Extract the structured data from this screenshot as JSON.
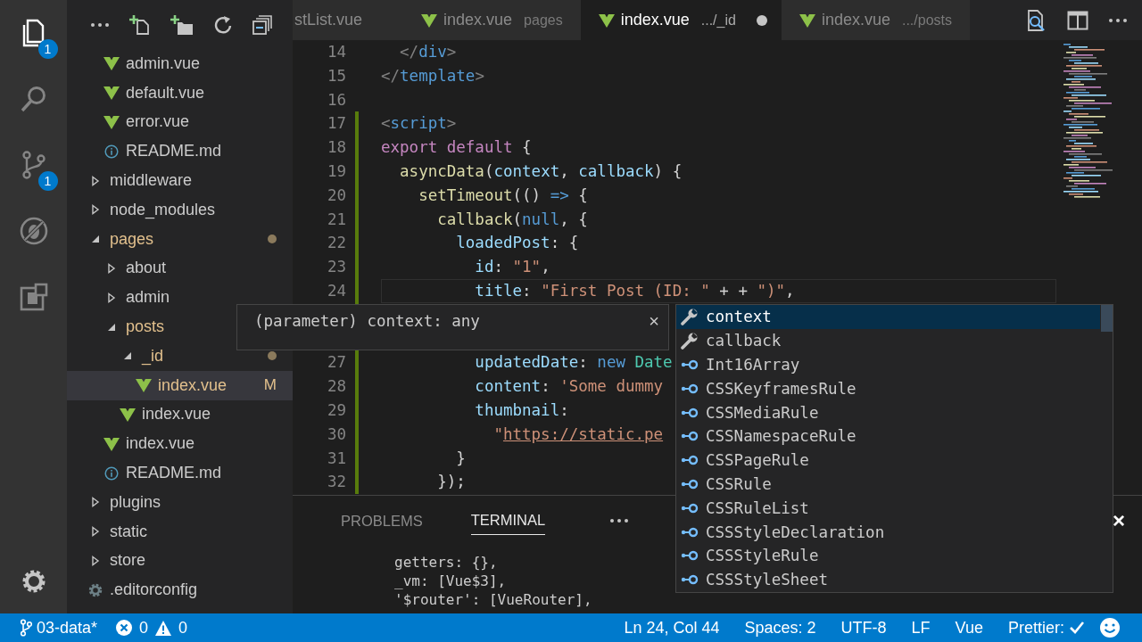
{
  "activity_bar": {
    "items": [
      {
        "kind": "files",
        "selected": true,
        "badge": "1"
      },
      {
        "kind": "search",
        "selected": false
      },
      {
        "kind": "branch",
        "selected": false,
        "badge": "1"
      },
      {
        "kind": "debug",
        "selected": false
      },
      {
        "kind": "extensions",
        "selected": false
      }
    ]
  },
  "sidebar": {
    "tree": [
      {
        "children": [
          {
            "label": "admin.vue",
            "kind": "vue",
            "selected": false
          },
          {
            "label": "default.vue",
            "kind": "vue",
            "selected": false
          },
          {
            "label": "error.vue",
            "kind": "vue",
            "selected": false
          },
          {
            "label": "README.md",
            "kind": "info",
            "selected": false
          }
        ]
      },
      {
        "label": "middleware",
        "kind": "folder",
        "expanded": false,
        "selected": false
      },
      {
        "label": "node_modules",
        "kind": "folder",
        "expanded": false,
        "selected": false
      },
      {
        "label": "pages",
        "kind": "folder",
        "expanded": true,
        "selected": false,
        "modified": true,
        "dot": true,
        "children": [
          {
            "label": "about",
            "kind": "folder",
            "expanded": false,
            "selected": false
          },
          {
            "label": "admin",
            "kind": "folder",
            "expanded": false,
            "selected": false
          },
          {
            "label": "posts",
            "kind": "folder",
            "expanded": true,
            "selected": false,
            "modified": true,
            "children": [
              {
                "label": "_id",
                "kind": "folder",
                "expanded": true,
                "selected": false,
                "modified": true,
                "dot": true,
                "children": [
                  {
                    "label": "index.vue",
                    "kind": "vue",
                    "selected": true,
                    "modified": true,
                    "badge": "M"
                  }
                ]
              },
              {
                "label": "index.vue",
                "kind": "vue",
                "selected": false
              }
            ]
          },
          {
            "label": "index.vue",
            "kind": "vue",
            "selected": false
          },
          {
            "label": "README.md",
            "kind": "info",
            "selected": false
          }
        ]
      },
      {
        "label": "plugins",
        "kind": "folder",
        "expanded": false,
        "selected": false
      },
      {
        "label": "static",
        "kind": "folder",
        "expanded": false,
        "selected": false
      },
      {
        "label": "store",
        "kind": "folder",
        "expanded": false,
        "selected": false
      },
      {
        "label": ".editorconfig",
        "kind": "config",
        "selected": false
      }
    ]
  },
  "tabs": [
    {
      "label": "stList.vue",
      "selected": false,
      "dirty": false
    },
    {
      "label": "index.vue",
      "detail": "pages",
      "kind": "vue",
      "selected": false,
      "dirty": false
    },
    {
      "label": "index.vue",
      "detail": ".../_id",
      "kind": "vue",
      "selected": true,
      "dirty": true
    },
    {
      "label": "index.vue",
      "detail": ".../posts",
      "kind": "vue",
      "selected": false,
      "dirty": false
    }
  ],
  "editor": {
    "lines": [
      {
        "kind": "code",
        "number": "14",
        "modified": false,
        "current": false,
        "tokens": [
          {
            "text": "  </",
            "kind": "bracket"
          },
          {
            "text": "div",
            "kind": "tag"
          },
          {
            "text": ">",
            "kind": "bracket"
          }
        ]
      },
      {
        "kind": "code",
        "number": "15",
        "modified": false,
        "current": false,
        "tokens": [
          {
            "text": "</",
            "kind": "bracket"
          },
          {
            "text": "template",
            "kind": "tag"
          },
          {
            "text": ">",
            "kind": "bracket"
          }
        ]
      },
      {
        "kind": "code",
        "number": "16",
        "modified": false
      },
      {
        "kind": "code",
        "number": "17",
        "modified": true,
        "current": false,
        "tokens": [
          {
            "text": "<",
            "kind": "bracket"
          },
          {
            "text": "script",
            "kind": "tag"
          },
          {
            "text": ">",
            "kind": "bracket"
          }
        ]
      },
      {
        "kind": "code",
        "number": "18",
        "modified": true,
        "current": false,
        "tokens": [
          {
            "text": "export default",
            "kind": "keyword"
          },
          {
            "text": " {",
            "kind": "punct"
          }
        ]
      },
      {
        "kind": "code",
        "number": "19",
        "modified": true,
        "current": false,
        "tokens": [
          {
            "text": "  asyncData",
            "kind": "function"
          },
          {
            "text": "(",
            "kind": "punct"
          },
          {
            "text": "context",
            "kind": "variable"
          },
          {
            "text": ", ",
            "kind": "punct"
          },
          {
            "text": "callback",
            "kind": "variable"
          },
          {
            "text": ") {",
            "kind": "punct"
          }
        ]
      },
      {
        "kind": "code",
        "number": "20",
        "modified": true,
        "current": false,
        "tokens": [
          {
            "text": "    setTimeout",
            "kind": "function"
          },
          {
            "text": "(() ",
            "kind": "punct"
          },
          {
            "text": "=>",
            "kind": "constant"
          },
          {
            "text": " {",
            "kind": "punct"
          }
        ]
      },
      {
        "kind": "code",
        "number": "21",
        "modified": true,
        "current": false,
        "tokens": [
          {
            "text": "      callback",
            "kind": "function"
          },
          {
            "text": "(",
            "kind": "punct"
          },
          {
            "text": "null",
            "kind": "constant"
          },
          {
            "text": ", {",
            "kind": "punct"
          }
        ]
      },
      {
        "kind": "code",
        "number": "22",
        "modified": true,
        "current": false,
        "tokens": [
          {
            "text": "        loadedPost",
            "kind": "variable"
          },
          {
            "text": ": {",
            "kind": "punct"
          }
        ]
      },
      {
        "kind": "code",
        "number": "23",
        "modified": true,
        "current": false,
        "tokens": [
          {
            "text": "          id",
            "kind": "variable"
          },
          {
            "text": ": ",
            "kind": "punct"
          },
          {
            "text": "\"1\"",
            "kind": "string"
          },
          {
            "text": ",",
            "kind": "punct"
          }
        ]
      },
      {
        "kind": "code",
        "number": "24",
        "modified": true,
        "current": true,
        "tokens": [
          {
            "text": "          title",
            "kind": "variable"
          },
          {
            "text": ": ",
            "kind": "punct"
          },
          {
            "text": "\"First Post (ID: \"",
            "kind": "string"
          },
          {
            "text": " + + ",
            "kind": "punct"
          },
          {
            "text": "\")\"",
            "kind": "string"
          },
          {
            "text": ",",
            "kind": "punct"
          }
        ]
      },
      {
        "kind": "covered",
        "modified": true
      },
      {
        "kind": "covered",
        "modified": true
      },
      {
        "kind": "code",
        "number": "27",
        "modified": true,
        "current": false,
        "tokens": [
          {
            "text": "          updatedDate",
            "kind": "variable"
          },
          {
            "text": ": ",
            "kind": "punct"
          },
          {
            "text": "new ",
            "kind": "constant"
          },
          {
            "text": "Date",
            "kind": "class"
          }
        ]
      },
      {
        "kind": "code",
        "number": "28",
        "modified": true,
        "current": false,
        "tokens": [
          {
            "text": "          content",
            "kind": "variable"
          },
          {
            "text": ": ",
            "kind": "punct"
          },
          {
            "text": "'Some dummy",
            "kind": "string"
          }
        ]
      },
      {
        "kind": "code",
        "number": "29",
        "modified": true,
        "current": false,
        "tokens": [
          {
            "text": "          thumbnail",
            "kind": "variable"
          },
          {
            "text": ":",
            "kind": "punct"
          }
        ]
      },
      {
        "kind": "code",
        "number": "30",
        "modified": true,
        "current": false,
        "tokens": [
          {
            "text": "            \"",
            "kind": "string"
          },
          {
            "text": "https://static.pe",
            "kind": "link"
          }
        ]
      },
      {
        "kind": "code",
        "number": "31",
        "modified": true,
        "current": false,
        "tokens": [
          {
            "text": "        }",
            "kind": "punct"
          }
        ]
      },
      {
        "kind": "code",
        "number": "32",
        "modified": true,
        "current": false,
        "tokens": [
          {
            "text": "      });",
            "kind": "punct"
          }
        ]
      }
    ]
  },
  "hover": {
    "text": "(parameter) context: any",
    "close": "×"
  },
  "suggestions": [
    {
      "label": "context",
      "kind": "variable",
      "selected": true
    },
    {
      "label": "callback",
      "kind": "variable",
      "selected": false
    },
    {
      "label": "Int16Array",
      "kind": "interface",
      "selected": false
    },
    {
      "label": "CSSKeyframesRule",
      "kind": "interface",
      "selected": false
    },
    {
      "label": "CSSMediaRule",
      "kind": "interface",
      "selected": false
    },
    {
      "label": "CSSNamespaceRule",
      "kind": "interface",
      "selected": false
    },
    {
      "label": "CSSPageRule",
      "kind": "interface",
      "selected": false
    },
    {
      "label": "CSSRule",
      "kind": "interface",
      "selected": false
    },
    {
      "label": "CSSRuleList",
      "kind": "interface",
      "selected": false
    },
    {
      "label": "CSSStyleDeclaration",
      "kind": "interface",
      "selected": false
    },
    {
      "label": "CSSStyleRule",
      "kind": "interface",
      "selected": false
    },
    {
      "label": "CSSStyleSheet",
      "kind": "interface",
      "selected": false
    }
  ],
  "panel": {
    "tabs": [
      {
        "label": "PROBLEMS",
        "selected": false
      },
      {
        "label": "TERMINAL",
        "selected": true
      }
    ],
    "close": "×",
    "terminal_lines": [
      "getters: {},",
      "_vm: [Vue$3],",
      "'$router': [VueRouter],"
    ]
  },
  "status_bar": {
    "branch": "03-data*",
    "errors": "0",
    "warnings": "0",
    "items": [
      {
        "text": "Ln 24, Col 44"
      },
      {
        "text": "Spaces: 2"
      },
      {
        "text": "UTF-8"
      },
      {
        "text": "LF"
      },
      {
        "text": "Vue"
      },
      {
        "text": "Prettier:",
        "kind": "check"
      }
    ]
  }
}
